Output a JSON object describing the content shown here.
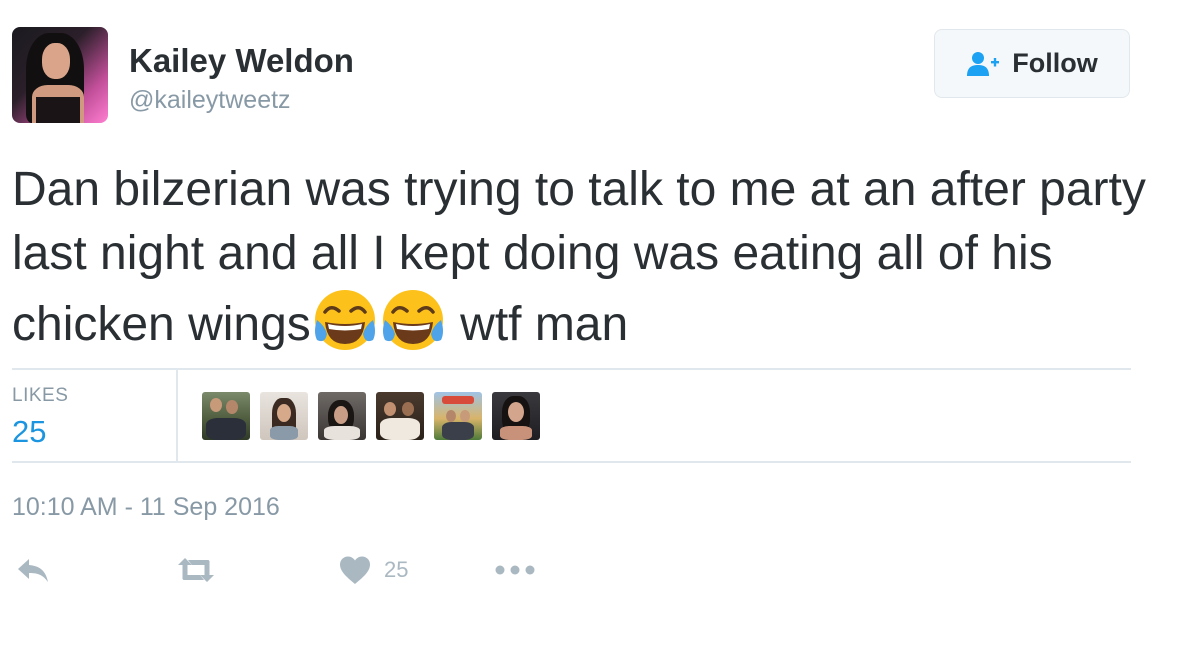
{
  "tweet": {
    "author_name": "Kailey Weldon",
    "author_handle": "@kaileytweetz",
    "follow_label": "Follow",
    "text_part1": "Dan bilzerian was trying to talk to me at an after party last night and all I kept doing was eating all of his chicken wings",
    "text_part2": " wtf man",
    "emoji": [
      "face-with-tears-of-joy",
      "face-with-tears-of-joy"
    ],
    "likes_label": "LIKES",
    "likes_count": "25",
    "liker_avatar_count": 6,
    "timestamp": "10:10 AM - 11 Sep 2016",
    "actions": {
      "reply_icon": "reply-icon",
      "retweet_icon": "retweet-icon",
      "like_icon": "heart-icon",
      "like_count": "25",
      "more_icon": "more-icon"
    }
  },
  "colors": {
    "text": "#292f33",
    "secondary": "#8899a6",
    "likes_blue": "#1b95e0",
    "follow_icon_blue": "#1da1f2",
    "action_gray": "#aab8c2",
    "divider": "#e1e8ed"
  }
}
